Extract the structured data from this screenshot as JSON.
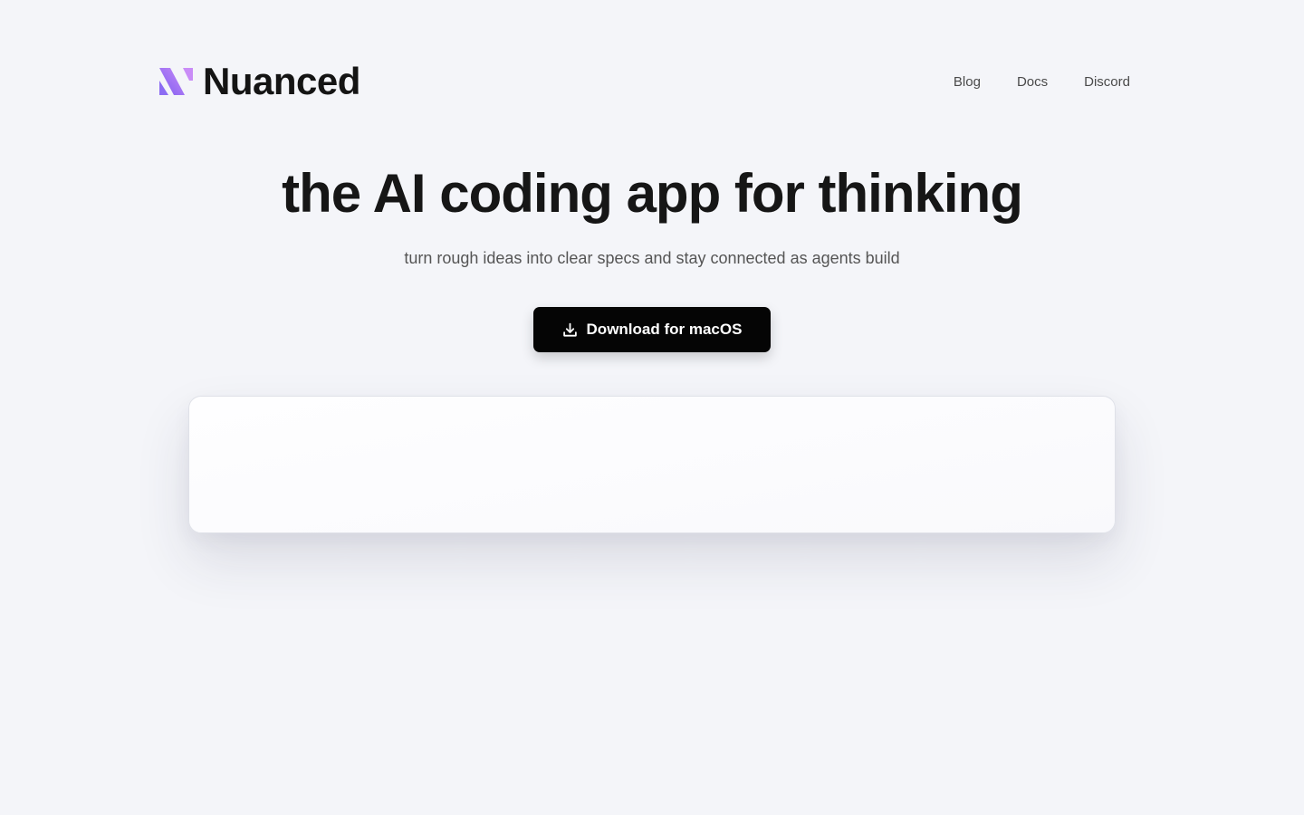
{
  "brand": {
    "name": "Nuanced",
    "logo_icon": "nuanced-logo-icon",
    "logo_colors": [
      "#8b5cf6",
      "#c084fc"
    ]
  },
  "nav": {
    "items": [
      {
        "label": "Blog"
      },
      {
        "label": "Docs"
      },
      {
        "label": "Discord"
      }
    ]
  },
  "hero": {
    "title": "the AI coding app for thinking",
    "subtitle": "turn rough ideas into clear specs and stay connected as agents build"
  },
  "cta": {
    "label": "Download for macOS",
    "icon": "download-icon",
    "background": "#050505"
  },
  "theme": {
    "page_background": "#f4f5f9",
    "text": "#161616",
    "muted_text": "#555555"
  }
}
